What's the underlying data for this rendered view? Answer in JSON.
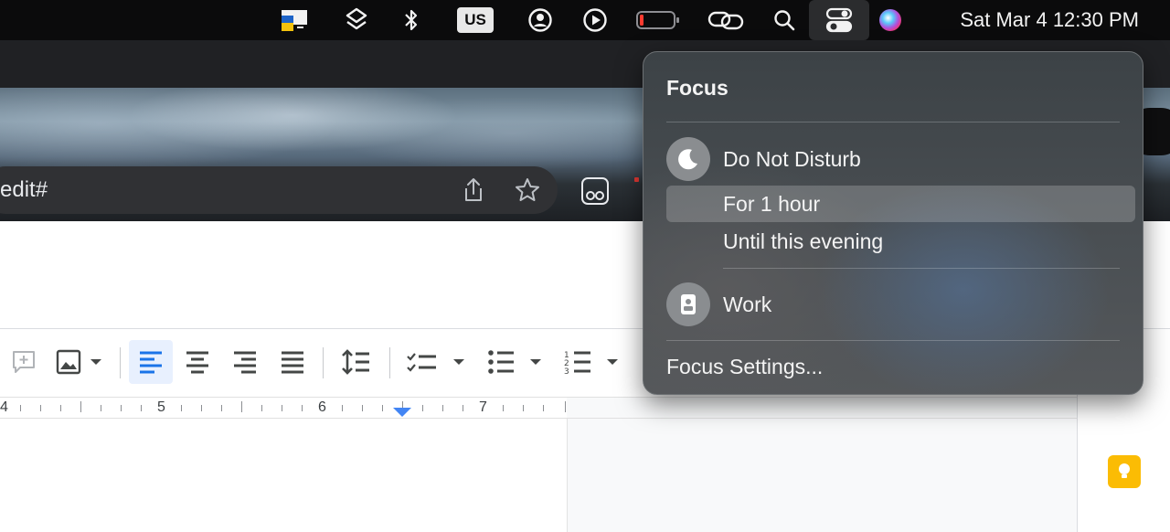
{
  "menubar": {
    "input_source": "US",
    "clock": "Sat Mar 4  12:30 PM",
    "icons": [
      "screen-app-icon",
      "layers-icon",
      "bluetooth-icon",
      "keyboard-input-icon",
      "user-account-icon",
      "play-icon",
      "battery-icon",
      "link-icon",
      "search-icon",
      "control-center-icon",
      "siri-icon"
    ]
  },
  "browser": {
    "url_fragment": "edit#",
    "icons": [
      "share-icon",
      "star-icon",
      "extension-icon"
    ]
  },
  "docs": {
    "ruler_numbers": [
      "4",
      "5",
      "6",
      "7"
    ],
    "toolbar_icons": [
      "add-comment-icon",
      "insert-image-icon",
      "align-left-icon",
      "align-center-icon",
      "align-right-icon",
      "justify-icon",
      "line-spacing-icon",
      "checklist-icon",
      "bullet-list-icon",
      "numbered-list-icon"
    ],
    "side_icons": [
      "keep-icon"
    ]
  },
  "focus": {
    "title": "Focus",
    "dnd_label": "Do Not Disturb",
    "option_1": "For 1 hour",
    "option_2": "Until this evening",
    "work_label": "Work",
    "settings_label": "Focus Settings..."
  },
  "colors": {
    "menubar": "#0b0b0c",
    "focus_panel": "#4a4f53",
    "accent_blue": "#4285f4",
    "keep_yellow": "#fbbc04"
  }
}
